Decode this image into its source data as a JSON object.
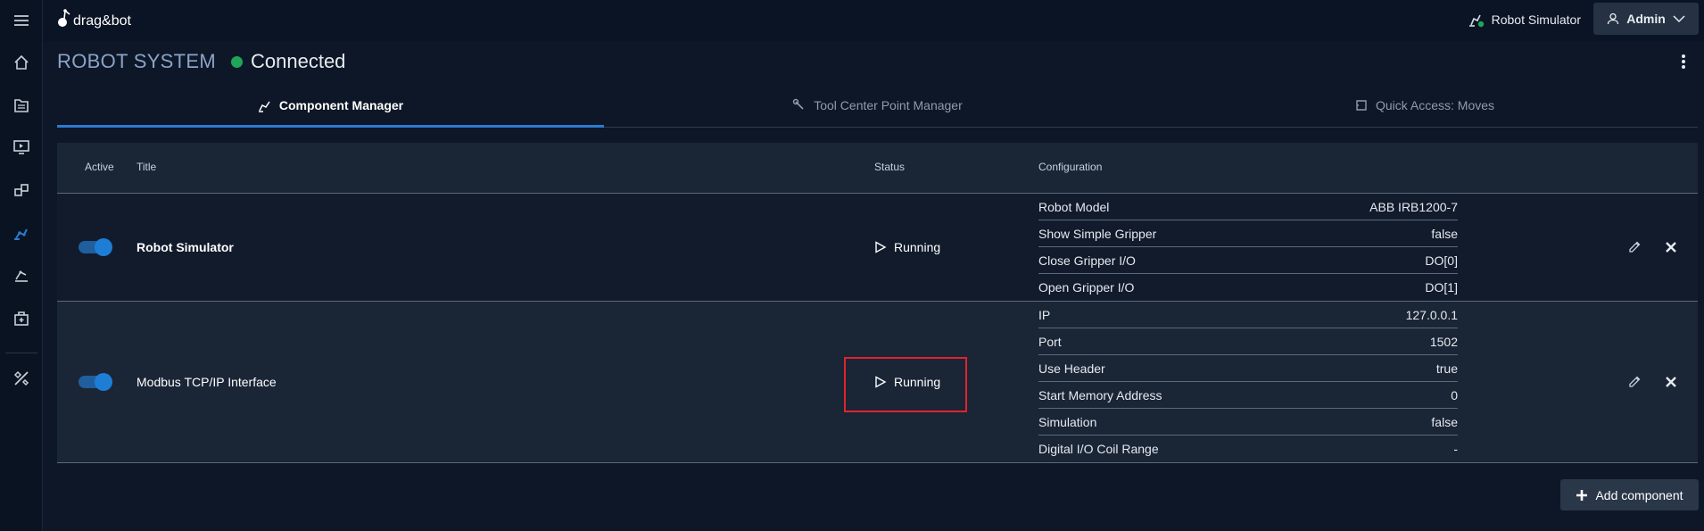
{
  "app": {
    "logo_text": "drag&bot"
  },
  "topbar": {
    "robot_label": "Robot Simulator",
    "user_label": "Admin"
  },
  "header": {
    "system_label": "ROBOT SYSTEM",
    "status_text": "Connected"
  },
  "tabs": [
    {
      "label": "Component Manager",
      "icon": "robot-arm-icon",
      "active": true
    },
    {
      "label": "Tool Center Point Manager",
      "icon": "wrench-icon",
      "active": false
    },
    {
      "label": "Quick Access: Moves",
      "icon": "tag-icon",
      "active": false
    }
  ],
  "table": {
    "columns": {
      "active": "Active",
      "title": "Title",
      "status": "Status",
      "configuration": "Configuration"
    },
    "rows": [
      {
        "title": "Robot Simulator",
        "active": true,
        "status": "Running",
        "config": [
          {
            "key": "Robot Model",
            "value": "ABB IRB1200-7"
          },
          {
            "key": "Show Simple Gripper",
            "value": "false"
          },
          {
            "key": "Close Gripper I/O",
            "value": "DO[0]"
          },
          {
            "key": "Open Gripper I/O",
            "value": "DO[1]"
          }
        ]
      },
      {
        "title": "Modbus TCP/IP Interface",
        "active": true,
        "status": "Running",
        "config": [
          {
            "key": "IP",
            "value": "127.0.0.1"
          },
          {
            "key": "Port",
            "value": "1502"
          },
          {
            "key": "Use Header",
            "value": "true"
          },
          {
            "key": "Start Memory Address",
            "value": "0"
          },
          {
            "key": "Simulation",
            "value": "false"
          },
          {
            "key": "Digital I/O Coil Range",
            "value": "-"
          }
        ]
      }
    ]
  },
  "actions": {
    "add_component_label": "Add component"
  },
  "colors": {
    "background": "#0d1727",
    "accent": "#2b7bd0",
    "connected": "#1fa55a",
    "highlight_box": "#e0242b"
  }
}
